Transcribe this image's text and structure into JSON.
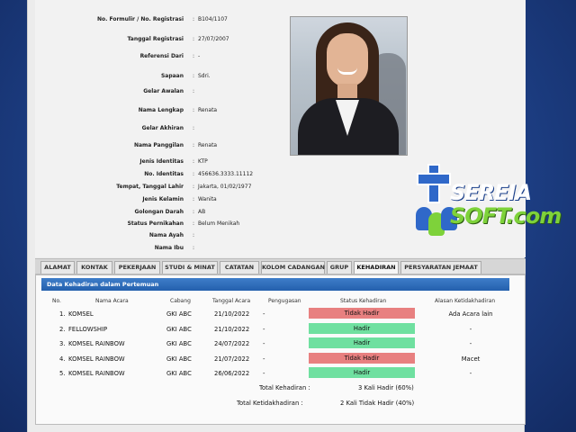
{
  "profile": {
    "fields": [
      {
        "label": "No. Formulir / No. Registrasi",
        "value": "B104/1107"
      },
      {
        "label": "Tanggal Registrasi",
        "value": "27/07/2007"
      },
      {
        "label": "Referensi Dari",
        "value": "-"
      },
      {
        "label": "Sapaan",
        "value": "Sdri."
      },
      {
        "label": "Gelar Awalan",
        "value": ""
      },
      {
        "label": "Nama Lengkap",
        "value": "Renata"
      },
      {
        "label": "Gelar Akhiran",
        "value": ""
      },
      {
        "label": "Nama Panggilan",
        "value": "Renata"
      },
      {
        "label": "Jenis Identitas",
        "value": "KTP"
      },
      {
        "label": "No. Identitas",
        "value": "456636.3333.11112"
      },
      {
        "label": "Tempat, Tanggal Lahir",
        "value": "Jakarta, 01/02/1977"
      },
      {
        "label": "Jenis Kelamin",
        "value": "Wanita"
      },
      {
        "label": "Golongan Darah",
        "value": "AB"
      },
      {
        "label": "Status Pernikahan",
        "value": "Belum Menikah"
      },
      {
        "label": "Nama Ayah",
        "value": ""
      },
      {
        "label": "Nama Ibu",
        "value": ""
      }
    ],
    "separator": ":"
  },
  "logo": {
    "line1": "SEREIA",
    "line2": "SOFT.com"
  },
  "tabs": [
    {
      "label": "ALAMAT"
    },
    {
      "label": "KONTAK"
    },
    {
      "label": "PEKERJAAN"
    },
    {
      "label": "STUDI & MINAT"
    },
    {
      "label": "CATATAN"
    },
    {
      "label": "KOLOM CADANGAN"
    },
    {
      "label": "GRUP"
    },
    {
      "label": "KEHADIRAN"
    },
    {
      "label": "PERSYARATAN JEMAAT"
    }
  ],
  "attendance": {
    "title": "Data Kehadiran dalam Pertemuan",
    "columns": [
      "No.",
      "Nama Acara",
      "Cabang",
      "Tanggal Acara",
      "Pengugasan",
      "Status Kehadiran",
      "Alasan Ketidakhadiran"
    ],
    "rows": [
      {
        "no": "1.",
        "acara": "KOMSEL",
        "cabang": "GKI ABC",
        "tanggal": "21/10/2022",
        "pengugasan": "-",
        "status": "Tidak Hadir",
        "alasan": "Ada Acara lain"
      },
      {
        "no": "2.",
        "acara": "FELLOWSHIP",
        "cabang": "GKI ABC",
        "tanggal": "21/10/2022",
        "pengugasan": "-",
        "status": "Hadir",
        "alasan": "-"
      },
      {
        "no": "3.",
        "acara": "KOMSEL RAINBOW",
        "cabang": "GKI ABC",
        "tanggal": "24/07/2022",
        "pengugasan": "-",
        "status": "Hadir",
        "alasan": "-"
      },
      {
        "no": "4.",
        "acara": "KOMSEL RAINBOW",
        "cabang": "GKI ABC",
        "tanggal": "21/07/2022",
        "pengugasan": "-",
        "status": "Tidak Hadir",
        "alasan": "Macet"
      },
      {
        "no": "5.",
        "acara": "KOMSEL RAINBOW",
        "cabang": "GKI ABC",
        "tanggal": "26/06/2022",
        "pengugasan": "-",
        "status": "Hadir",
        "alasan": "-"
      }
    ],
    "summary": {
      "total_hadir_label": "Total Kehadiran :",
      "total_hadir_value": "3 Kali Hadir (60%)",
      "total_tidak_label": "Total Ketidakhadiran :",
      "total_tidak_value": "2 Kali Tidak Hadir (40%)"
    }
  },
  "colors": {
    "hadir": "#6fe0a0",
    "tidak_hadir": "#e88080",
    "header_blue": "#2460ad"
  }
}
